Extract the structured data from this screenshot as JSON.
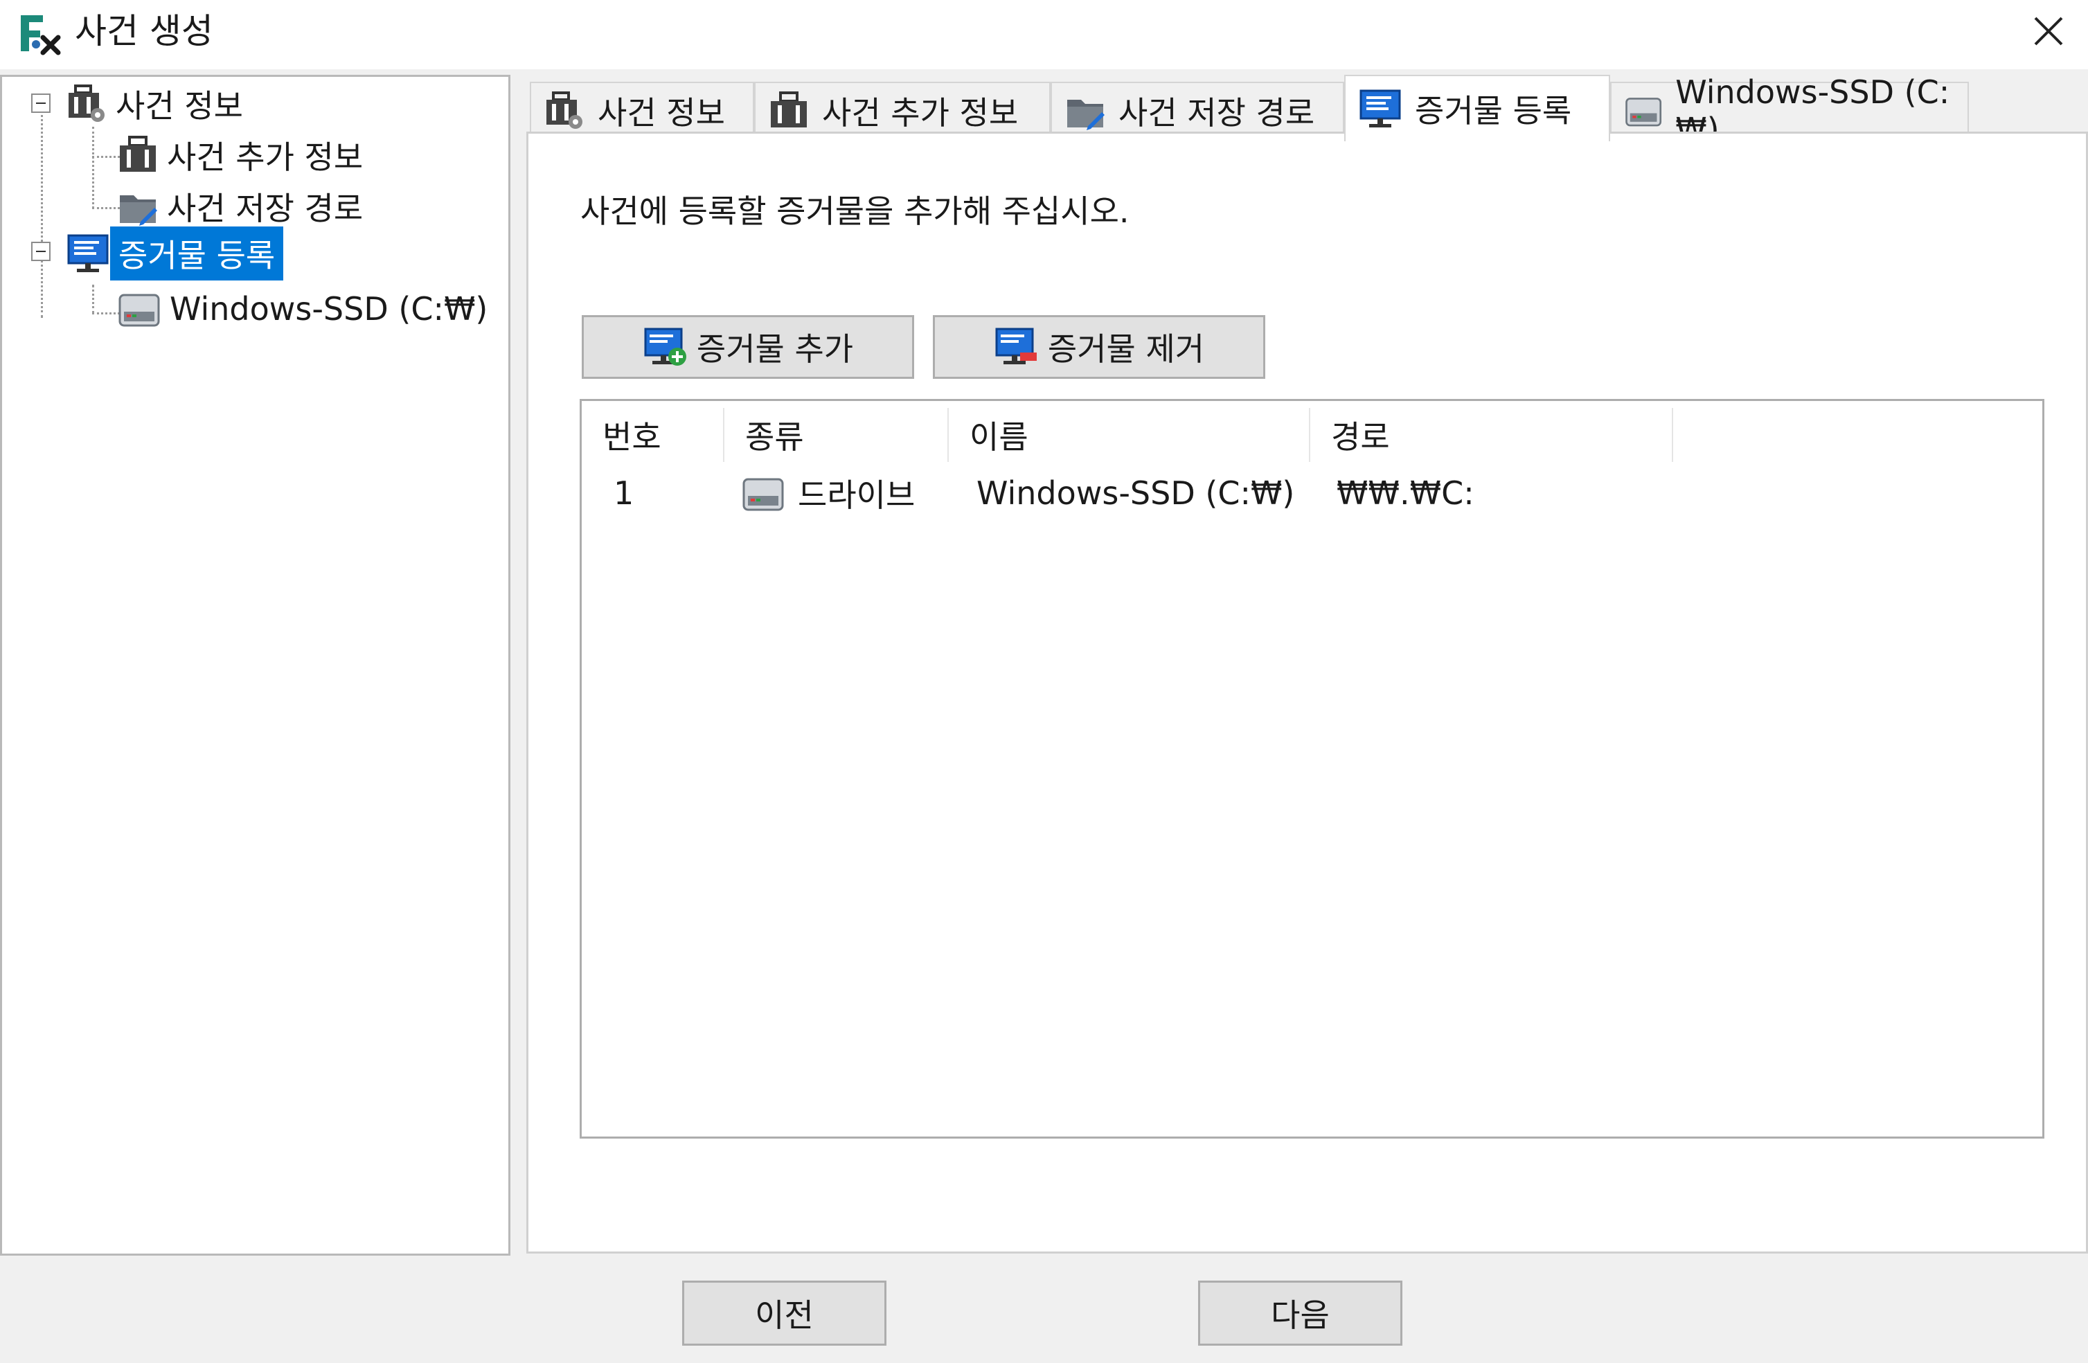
{
  "window": {
    "title": "사건 생성"
  },
  "tree": {
    "items": [
      {
        "label": "사건 정보",
        "icon": "briefcase-gear-icon"
      },
      {
        "label": "사건 추가 정보",
        "icon": "briefcase-icon"
      },
      {
        "label": "사건 저장 경로",
        "icon": "folder-pen-icon"
      },
      {
        "label": "증거물 등록",
        "icon": "monitor-icon",
        "selected": true
      },
      {
        "label": "Windows-SSD (C:₩)",
        "icon": "drive-icon"
      }
    ]
  },
  "tabs": [
    {
      "label": "사건 정보",
      "icon": "briefcase-gear-icon"
    },
    {
      "label": "사건 추가 정보",
      "icon": "briefcase-icon"
    },
    {
      "label": "사건 저장 경로",
      "icon": "folder-pen-icon"
    },
    {
      "label": "증거물 등록",
      "icon": "monitor-icon",
      "active": true
    },
    {
      "label": "Windows-SSD (C:₩)",
      "icon": "drive-icon"
    }
  ],
  "content": {
    "instruction": "사건에 등록할 증거물을 추가해 주십시오.",
    "add_button": "증거물 추가",
    "remove_button": "증거물 제거"
  },
  "evidence_table": {
    "columns": [
      "번호",
      "종류",
      "이름",
      "경로"
    ],
    "rows": [
      {
        "number": "1",
        "type": "드라이브",
        "name": "Windows-SSD (C:₩)",
        "path": "₩₩.₩C:"
      }
    ]
  },
  "footer": {
    "prev_label": "이전",
    "next_label": "다음"
  },
  "colors": {
    "selection": "#0078d7",
    "monitor_blue": "#1e6fd9",
    "window_bg": "#f0f0f0"
  }
}
